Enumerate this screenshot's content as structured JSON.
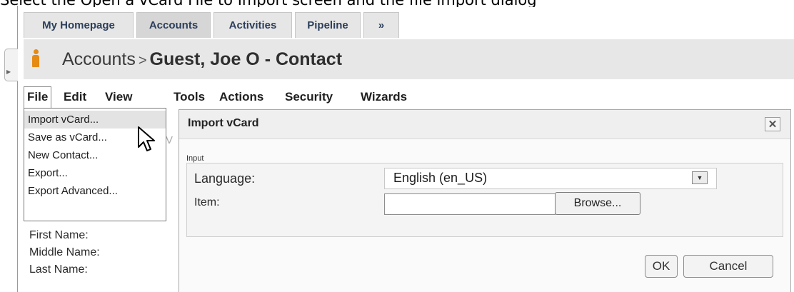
{
  "top_banner_text": "Select the Open a vCard File to Import screen and the file import dialog",
  "tabs": [
    "My Homepage",
    "Accounts",
    "Activities",
    "Pipeline",
    "»"
  ],
  "active_tab": "Accounts",
  "title": {
    "crumb": "Accounts",
    "separator": ">",
    "record": "Guest, Joe O - Contact"
  },
  "menubar": [
    "File",
    "Edit",
    "View",
    "Tools",
    "Actions",
    "Security",
    "Wizards"
  ],
  "file_menu": {
    "items": [
      "Import vCard...",
      "Save as vCard...",
      "New Contact...",
      "Export...",
      "Export Advanced..."
    ],
    "highlighted": "Import vCard..."
  },
  "form_labels": [
    "First Name:",
    "Middle Name:",
    "Last Name:"
  ],
  "dialog": {
    "title": "Import vCard",
    "close_label": "✕",
    "fieldset_legend": "Input",
    "language_label": "Language:",
    "language_value": "English (en_US)",
    "item_label": "Item:",
    "item_value": "",
    "browse_label": "Browse...",
    "ok_label": "OK",
    "cancel_label": "Cancel"
  },
  "colors": {
    "accent_icon": "#e58a12",
    "title_bar": "#e7e7e7",
    "tab_text": "#2c3e5a"
  },
  "icons": {
    "record": "person-icon",
    "cursor": "mouse-pointer-icon",
    "select_arrow": "chevron-down-icon",
    "close": "close-icon"
  }
}
